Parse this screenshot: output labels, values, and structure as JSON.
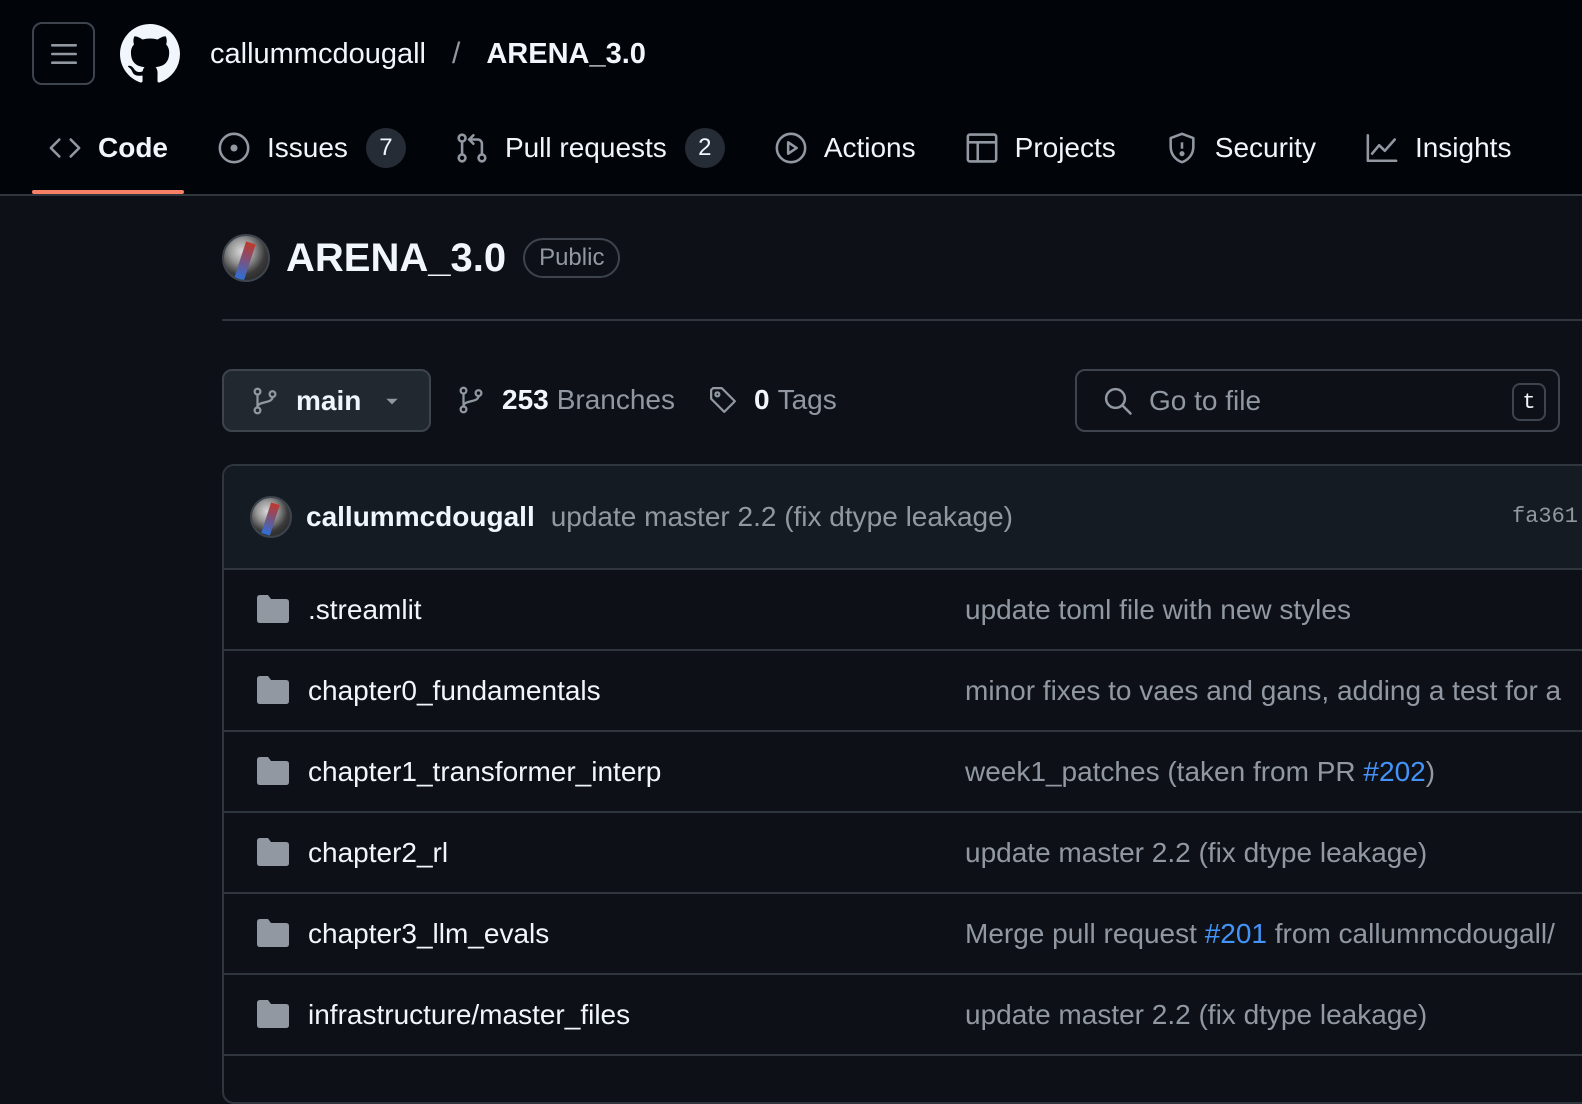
{
  "header": {
    "owner": "callummcdougall",
    "separator": "/",
    "repo": "ARENA_3.0"
  },
  "tabs": [
    {
      "label": "Code",
      "icon": "code-icon",
      "active": true
    },
    {
      "label": "Issues",
      "icon": "issue-opened-icon",
      "count": "7"
    },
    {
      "label": "Pull requests",
      "icon": "git-pull-request-icon",
      "count": "2"
    },
    {
      "label": "Actions",
      "icon": "play-icon"
    },
    {
      "label": "Projects",
      "icon": "table-icon"
    },
    {
      "label": "Security",
      "icon": "shield-icon"
    },
    {
      "label": "Insights",
      "icon": "graph-icon"
    }
  ],
  "repo_head": {
    "title": "ARENA_3.0",
    "visibility": "Public"
  },
  "branch_bar": {
    "branch": "main",
    "branches_count": "253",
    "branches_label": "Branches",
    "tags_count": "0",
    "tags_label": "Tags",
    "search_placeholder": "Go to file",
    "search_shortcut": "t"
  },
  "latest_commit": {
    "author": "callummcdougall",
    "message": "update master 2.2 (fix dtype leakage)",
    "sha": "fa361"
  },
  "files": [
    {
      "name": ".streamlit",
      "msg_pre": "update toml file with new styles",
      "link": "",
      "msg_post": ""
    },
    {
      "name": "chapter0_fundamentals",
      "msg_pre": "minor fixes to vaes and gans, adding a test for a",
      "link": "",
      "msg_post": ""
    },
    {
      "name": "chapter1_transformer_interp",
      "msg_pre": "week1_patches (taken from PR ",
      "link": "#202",
      "msg_post": ")"
    },
    {
      "name": "chapter2_rl",
      "msg_pre": "update master 2.2 (fix dtype leakage)",
      "link": "",
      "msg_post": ""
    },
    {
      "name": "chapter3_llm_evals",
      "msg_pre": "Merge pull request ",
      "link": "#201",
      "msg_post": " from callummcdougall/"
    },
    {
      "name": "infrastructure/master_files",
      "msg_pre": "update master 2.2 (fix dtype leakage)",
      "link": "",
      "msg_post": ""
    }
  ],
  "colors": {
    "header_bg": "#010409",
    "page_bg": "#0d1117",
    "active_tab_underline": "#f78166",
    "link": "#4493f8",
    "muted_text": "#9198a1"
  }
}
